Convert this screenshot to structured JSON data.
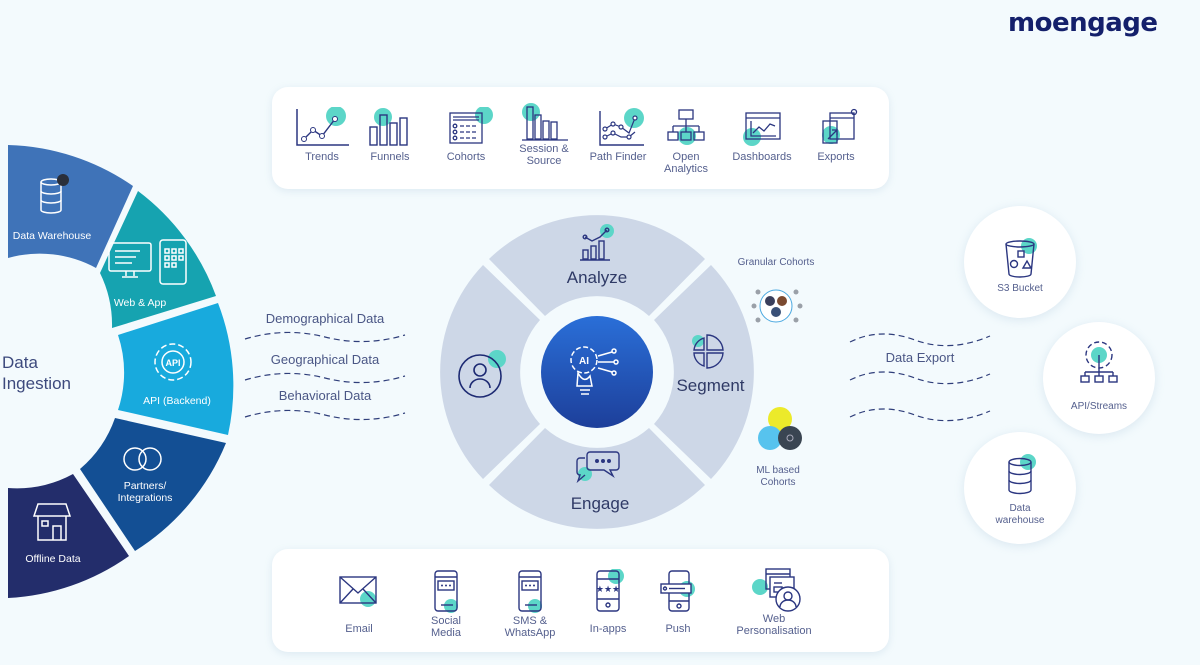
{
  "brand": {
    "logo_text": "moengage",
    "navy": "#14206b",
    "teal": "#5cd6c8"
  },
  "analytics_panel": {
    "tools": [
      {
        "label": "Trends",
        "icon": "trends-line-chart-icon"
      },
      {
        "label": "Funnels",
        "icon": "funnels-bar-chart-icon"
      },
      {
        "label": "Cohorts",
        "icon": "cohorts-table-icon"
      },
      {
        "label": "Session & Source",
        "icon": "session-source-bar-icon"
      },
      {
        "label": "Path Finder",
        "icon": "path-finder-icon"
      },
      {
        "label": "Open Analytics",
        "icon": "open-analytics-hierarchy-icon"
      },
      {
        "label": "Dashboards",
        "icon": "dashboard-window-icon"
      },
      {
        "label": "Exports",
        "icon": "exports-window-icon"
      }
    ]
  },
  "engage_panel": {
    "channels": [
      {
        "label": "Email",
        "icon": "email-envelope-icon"
      },
      {
        "label": "Social Media",
        "icon": "social-media-phone-icon"
      },
      {
        "label": "SMS & WhatsApp",
        "icon": "sms-phone-icon"
      },
      {
        "label": "In-apps",
        "icon": "in-app-phone-icon"
      },
      {
        "label": "Push",
        "icon": "push-phone-icon"
      },
      {
        "label": "Web Personalisation",
        "icon": "web-personalisation-icon"
      }
    ]
  },
  "ingestion": {
    "title_line1": "Data",
    "title_line2": "Ingestion",
    "sources": [
      {
        "label": "Data Warehouse",
        "color": "#3f73b8",
        "icon": "database-icon"
      },
      {
        "label": "Web & App",
        "color": "#16a3b0",
        "icon": "web-app-icon"
      },
      {
        "label": "API (Backend)",
        "color": "#18aadd",
        "icon": "api-gear-icon"
      },
      {
        "label": "Partners/ Integrations",
        "color": "#134f94",
        "icon": "partners-rings-icon"
      },
      {
        "label": "Offline Data",
        "color": "#232d6b",
        "icon": "store-icon"
      }
    ]
  },
  "data_types": [
    "Demographical Data",
    "Geographical Data",
    "Behavioral Data"
  ],
  "wheel": {
    "analyze": "Analyze",
    "segment": "Segment",
    "engage": "Engage",
    "left_icon": "user-profile-icon",
    "center_icon": "ai-lightbulb-icon"
  },
  "cohorts": {
    "granular": "Granular Cohorts",
    "ml": "ML based Cohorts"
  },
  "export": {
    "title": "Data Export",
    "targets": [
      {
        "label": "S3 Bucket",
        "icon": "s3-bucket-icon"
      },
      {
        "label": "API/Streams",
        "icon": "api-streams-icon"
      },
      {
        "label": "Data warehouse",
        "icon": "database-icon"
      }
    ]
  }
}
